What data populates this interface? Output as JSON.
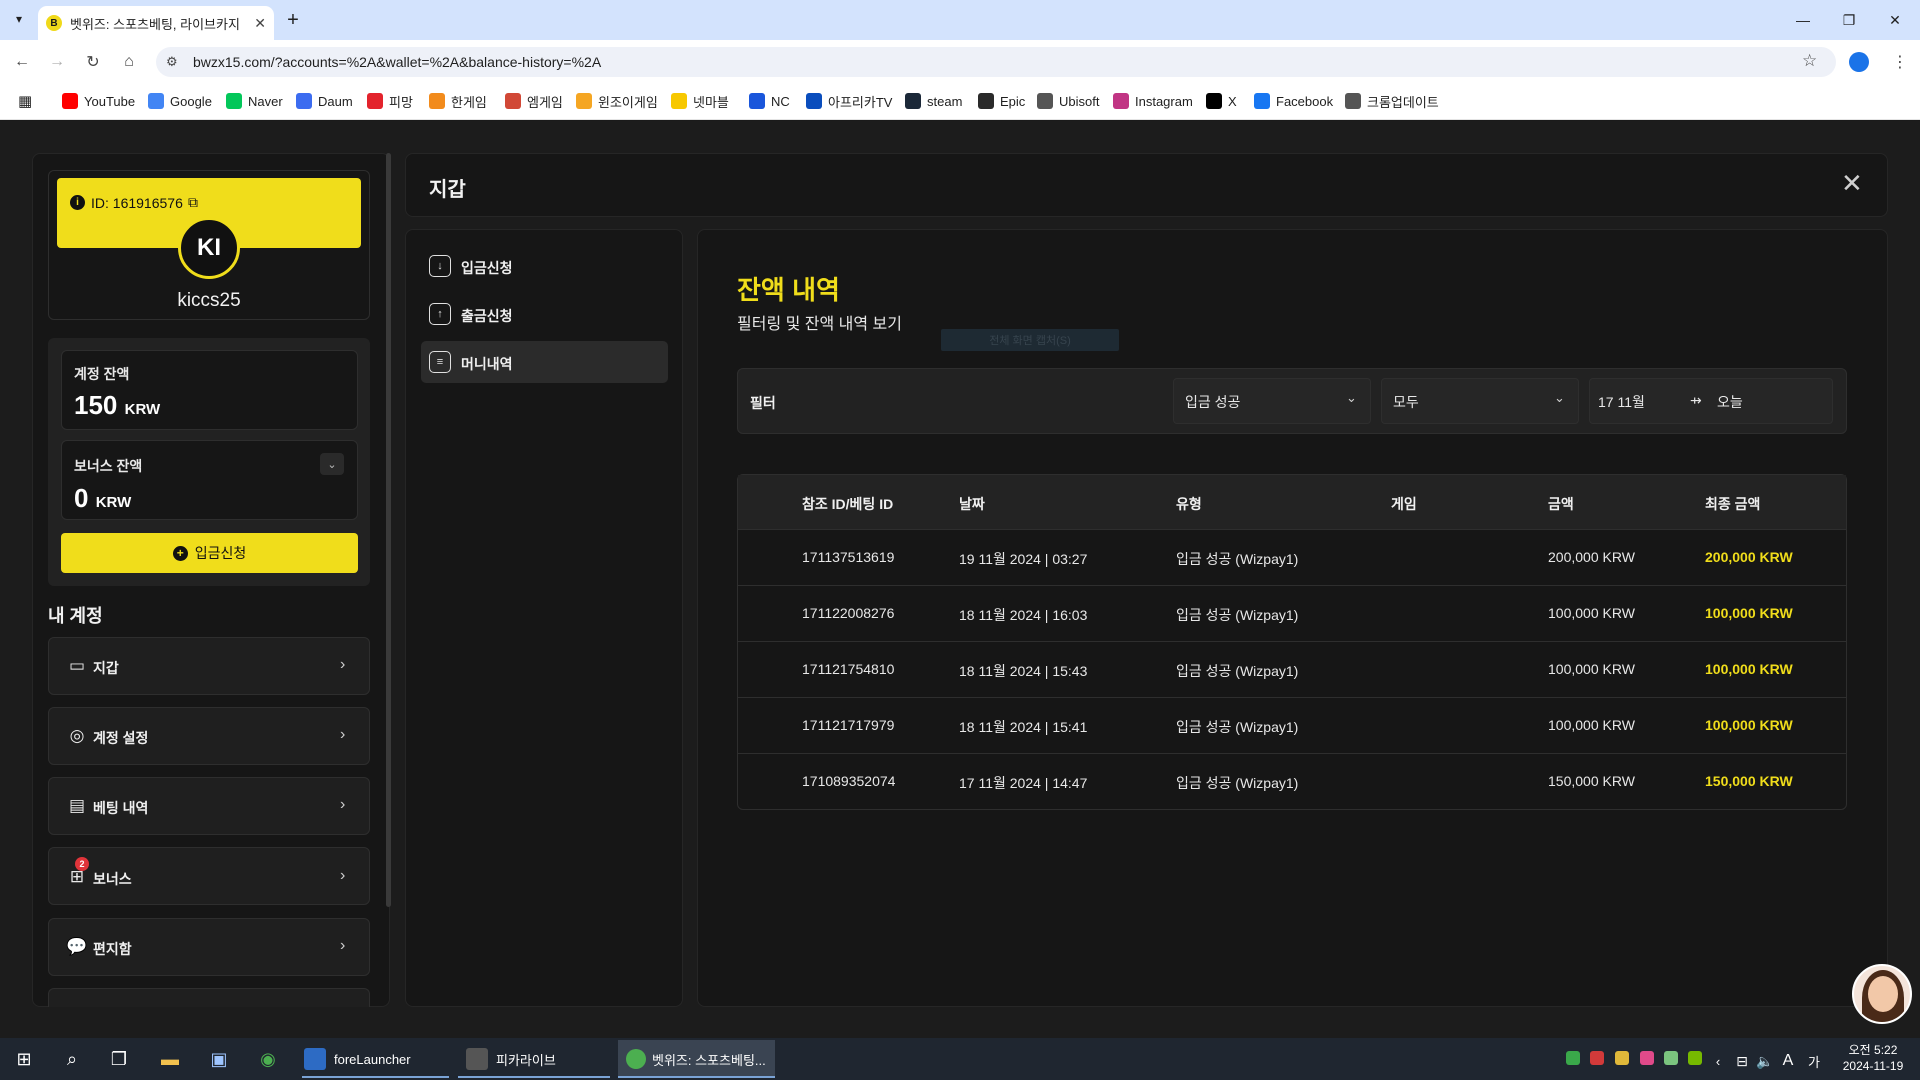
{
  "browser": {
    "tab_title": "벳위즈: 스포츠베팅, 라이브카지",
    "url": "bwzx15.com/?accounts=%2A&wallet=%2A&balance-history=%2A",
    "bookmarks": [
      "YouTube",
      "Google",
      "Naver",
      "Daum",
      "피망",
      "한게임",
      "엠게임",
      "윈조이게임",
      "넷마블",
      "NC",
      "아프리카TV",
      "steam",
      "Epic",
      "Ubisoft",
      "Instagram",
      "X",
      "Facebook",
      "크롬업데이트"
    ]
  },
  "sidebar": {
    "user_id": "ID: 161916576",
    "avatar_initials": "KI",
    "username": "kiccs25",
    "account_balance_label": "계정 잔액",
    "account_balance_value": "150",
    "account_balance_unit": "KRW",
    "bonus_balance_label": "보너스 잔액",
    "bonus_balance_value": "0",
    "bonus_balance_unit": "KRW",
    "deposit_button": "입금신청",
    "section_title": "내 계정",
    "bonus_badge": "2",
    "menu": [
      "지갑",
      "계정 설정",
      "베팅 내역",
      "보너스",
      "편지함"
    ]
  },
  "main": {
    "title": "지갑",
    "subnav": [
      "입금신청",
      "출금신청",
      "머니내역"
    ],
    "content_title": "잔액 내역",
    "content_subtitle": "필터링 및 잔액 내역 보기",
    "faint_button": "전체 화면 캡처(S)",
    "filter": {
      "label": "필터",
      "type_value": "입금 성공",
      "game_value": "모두",
      "date_from": "17 11월",
      "date_to": "오늘"
    },
    "table": {
      "headers": [
        "참조 ID/베팅 ID",
        "날짜",
        "유형",
        "게임",
        "금액",
        "최종 금액"
      ],
      "rows": [
        {
          "id": "171137513619",
          "date": "19 11월 2024 | 03:27",
          "type": "입금 성공 (Wizpay1)",
          "game": "",
          "amount": "200,000 KRW",
          "final": "200,000 KRW"
        },
        {
          "id": "171122008276",
          "date": "18 11월 2024 | 16:03",
          "type": "입금 성공 (Wizpay1)",
          "game": "",
          "amount": "100,000 KRW",
          "final": "100,000 KRW"
        },
        {
          "id": "171121754810",
          "date": "18 11월 2024 | 15:43",
          "type": "입금 성공 (Wizpay1)",
          "game": "",
          "amount": "100,000 KRW",
          "final": "100,000 KRW"
        },
        {
          "id": "171121717979",
          "date": "18 11월 2024 | 15:41",
          "type": "입금 성공 (Wizpay1)",
          "game": "",
          "amount": "100,000 KRW",
          "final": "100,000 KRW"
        },
        {
          "id": "171089352074",
          "date": "17 11월 2024 | 14:47",
          "type": "입금 성공 (Wizpay1)",
          "game": "",
          "amount": "150,000 KRW",
          "final": "150,000 KRW"
        }
      ]
    }
  },
  "taskbar": {
    "apps": [
      "foreLauncher",
      "피카라이브",
      "벳위즈: 스포츠베팅..."
    ],
    "clock_time": "오전 5:22",
    "clock_date": "2024-11-19",
    "ime": "A",
    "ime2": "가"
  },
  "colors": {
    "accent": "#f0dd1b",
    "background": "#1c1c1c",
    "panel": "#161616"
  }
}
